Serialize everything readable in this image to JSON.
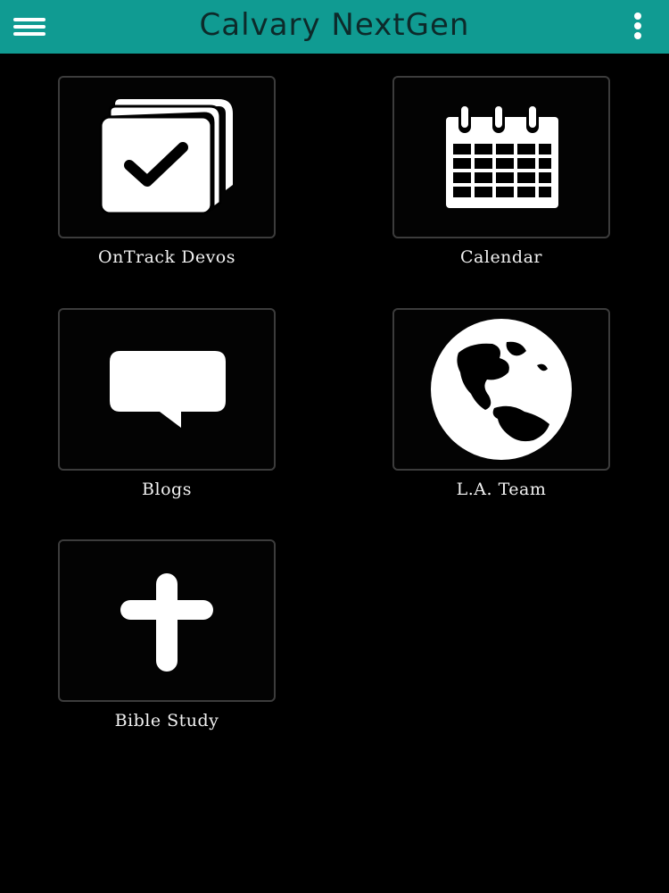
{
  "header": {
    "title": "Calvary NextGen",
    "menu_icon": "hamburger-menu-icon",
    "overflow_icon": "more-vertical-icon",
    "bar_color": "#109b92",
    "title_color": "#0d2a2a"
  },
  "tiles": [
    {
      "label": "OnTrack Devos",
      "icon": "checked-cards-icon"
    },
    {
      "label": "Calendar",
      "icon": "calendar-icon"
    },
    {
      "label": "Blogs",
      "icon": "speech-bubble-icon"
    },
    {
      "label": "L.A. Team",
      "icon": "globe-icon"
    },
    {
      "label": "Bible Study",
      "icon": "cross-icon"
    }
  ],
  "colors": {
    "background": "#000000",
    "tile_border": "#3c3c3c",
    "icon": "#ffffff",
    "label": "#f2f2f2"
  }
}
